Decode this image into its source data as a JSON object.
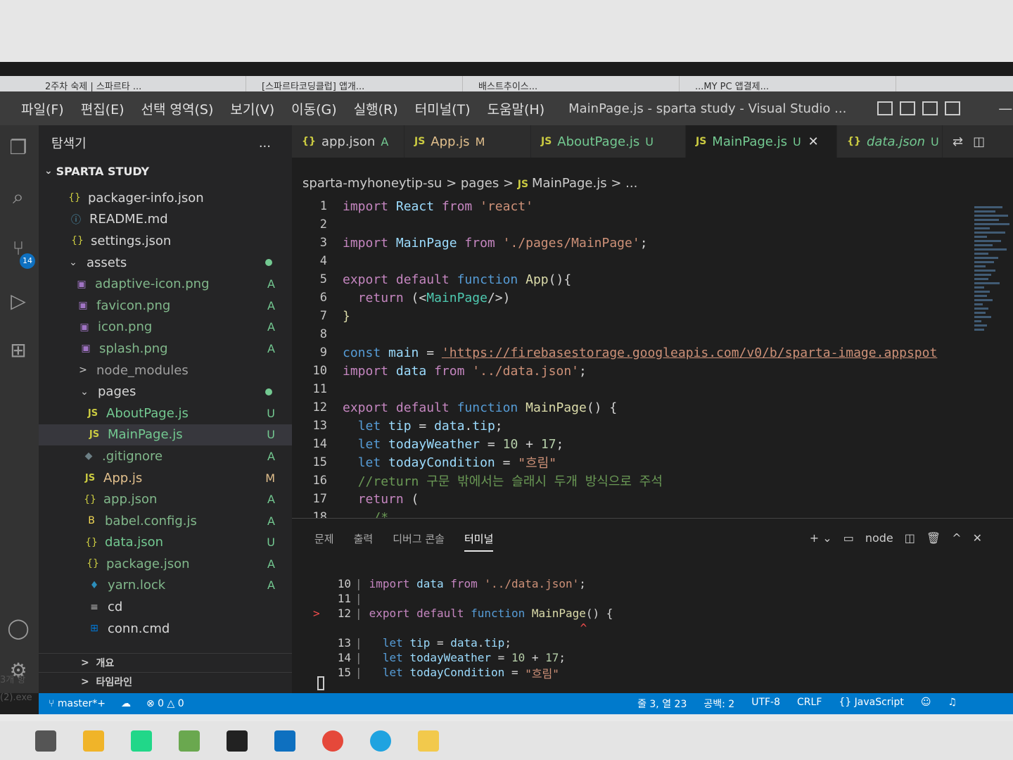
{
  "browser_tabs": [
    "2주차 숙제 | 스파르타 ...",
    "[스파르타코딩클럽] 앱개...",
    "배스트추이스...",
    "...MY PC 앱결제..."
  ],
  "menu": [
    "파일(F)",
    "편집(E)",
    "선택 영역(S)",
    "보기(V)",
    "이동(G)",
    "실행(R)",
    "터미널(T)",
    "도움말(H)"
  ],
  "window_title": "MainPage.js - sparta study - Visual Studio ...",
  "activity": {
    "scm_badge": "14"
  },
  "sidebar": {
    "title": "탐색기",
    "more": "...",
    "folder": "SPARTA STUDY",
    "items": [
      {
        "icon": "{}",
        "name": "packager-info.json",
        "status": ""
      },
      {
        "icon": "ⓘ",
        "name": "README.md",
        "status": ""
      },
      {
        "icon": "{}",
        "name": "settings.json",
        "status": ""
      },
      {
        "icon": "⌄",
        "name": "assets",
        "status": ""
      },
      {
        "icon": "▣",
        "name": "adaptive-icon.png",
        "status": "A"
      },
      {
        "icon": "▣",
        "name": "favicon.png",
        "status": "A"
      },
      {
        "icon": "▣",
        "name": "icon.png",
        "status": "A"
      },
      {
        "icon": "▣",
        "name": "splash.png",
        "status": "A"
      },
      {
        "icon": ">",
        "name": "node_modules",
        "status": ""
      },
      {
        "icon": "⌄",
        "name": "pages",
        "status": ""
      },
      {
        "icon": "JS",
        "name": "AboutPage.js",
        "status": "U"
      },
      {
        "icon": "JS",
        "name": "MainPage.js",
        "status": "U"
      },
      {
        "icon": "◆",
        "name": ".gitignore",
        "status": "A"
      },
      {
        "icon": "JS",
        "name": "App.js",
        "status": "M"
      },
      {
        "icon": "{}",
        "name": "app.json",
        "status": "A"
      },
      {
        "icon": "B",
        "name": "babel.config.js",
        "status": "A"
      },
      {
        "icon": "{}",
        "name": "data.json",
        "status": "U"
      },
      {
        "icon": "{}",
        "name": "package.json",
        "status": "A"
      },
      {
        "icon": "♦",
        "name": "yarn.lock",
        "status": "A"
      },
      {
        "icon": "≡",
        "name": "cd",
        "status": ""
      },
      {
        "icon": "⊞",
        "name": "conn.cmd",
        "status": ""
      }
    ],
    "outline": "개요",
    "timeline": "타임라인"
  },
  "tabs": [
    {
      "icon": "{}",
      "name": "app.json",
      "status": "A"
    },
    {
      "icon": "JS",
      "name": "App.js",
      "status": "M"
    },
    {
      "icon": "JS",
      "name": "AboutPage.js",
      "status": "U"
    },
    {
      "icon": "JS",
      "name": "MainPage.js",
      "status": "U",
      "close": "✕"
    },
    {
      "icon": "{}",
      "name": "data.json",
      "status": "U"
    }
  ],
  "breadcrumb": [
    "sparta-myhoneytip-su",
    "pages",
    "MainPage.js",
    "..."
  ],
  "code": {
    "l1": "1",
    "l2": "2",
    "l3": "3",
    "l4": "4",
    "l5": "5",
    "l6": "6",
    "l7": "7",
    "l8": "8",
    "l9": "9",
    "l10": "10",
    "l11": "11",
    "l12": "12",
    "l13": "13",
    "l14": "14",
    "l15": "15",
    "l16": "16",
    "l17": "17",
    "l18": "18",
    "url": "'https://firebasestorage.googleapis.com/v0/b/sparta-image.appspot",
    "comment": "//return 구문 밖에서는 슬래시 두개 방식으로 주석",
    "cond": "\"흐림\""
  },
  "panel": {
    "tabs": [
      "문제",
      "출력",
      "디버그 콘솔",
      "터미널"
    ],
    "terminal_name": "node",
    "lines": [
      {
        "n": "10",
        "text": "import data from '../data.json';"
      },
      {
        "n": "11",
        "text": ""
      },
      {
        "n": "12",
        "text": "export default function MainPage() {"
      },
      {
        "n": "13",
        "text": "let tip = data.tip;"
      },
      {
        "n": "14",
        "text": "let todayWeather = 10 + 17;"
      },
      {
        "n": "15",
        "text": "let todayCondition = \"흐림\""
      }
    ],
    "caret": "^"
  },
  "status": {
    "branch": "master*+",
    "errors": "0",
    "warnings": "0",
    "position": "줄 3, 열 23",
    "spaces": "공백: 2",
    "encoding": "UTF-8",
    "eol": "CRLF",
    "language": "JavaScript"
  },
  "desktop": {
    "text1": "3개 항",
    "text2": "(2).exe"
  }
}
